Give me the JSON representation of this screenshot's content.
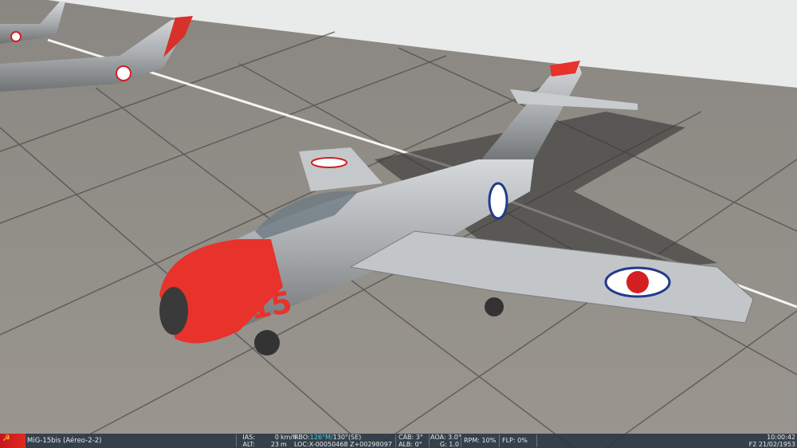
{
  "aircraft": {
    "name": "MiG-15bis (Aéreo-2-2)",
    "number": "015",
    "flag_icon": "hammer-sickle-icon"
  },
  "hud": {
    "ias_label": "IAS:",
    "ias_value": "0",
    "ias_unit": "km/h",
    "alt_label": "ALT:",
    "alt_value": "23",
    "alt_unit": "m",
    "rbo_label": "RBO:",
    "rbo_value": "126°M/",
    "rbo_value2": "130°(SE)",
    "loc_label": "LOC:",
    "loc_value": "X-00050468 Z+00298097",
    "cab": "CAB: 3°",
    "alb": "ALB: 0°",
    "aoa": "AOA: 3.0°",
    "g": "G: 1.0",
    "rpm": "RPM: 10%",
    "flp": "FLP: 0%",
    "time": "10:00:42",
    "date": "F2 21/02/1953"
  },
  "colors": {
    "accent": "#3fd0e0",
    "nose_red": "#e8322c",
    "hud_bg": "#28344299"
  }
}
